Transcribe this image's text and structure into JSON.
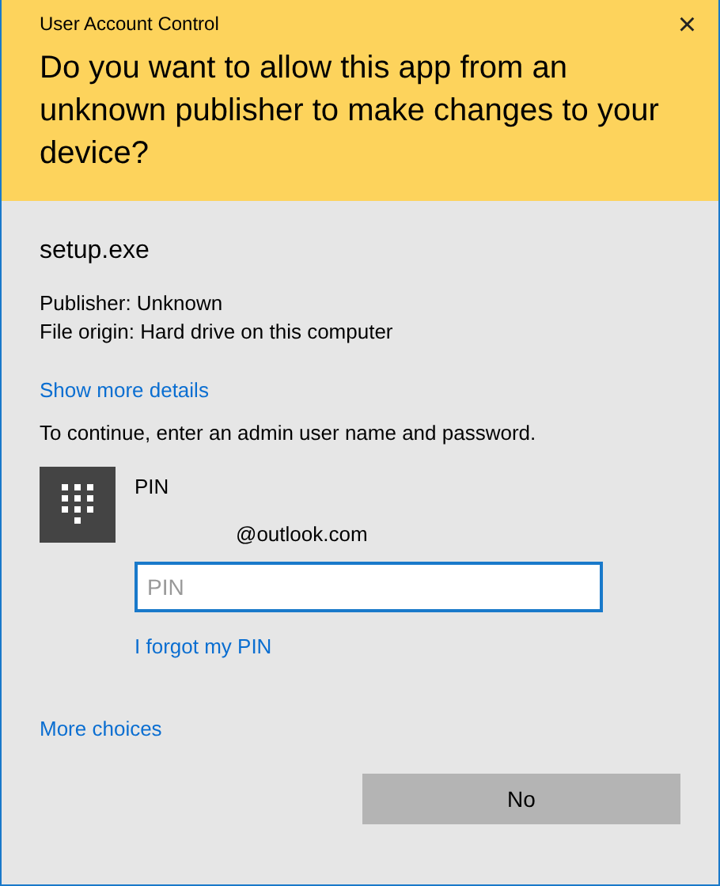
{
  "window": {
    "title": "User Account Control",
    "close": "×"
  },
  "question": "Do you want to allow this app from an unknown publisher to make changes to your device?",
  "app": {
    "name": "setup.exe",
    "publisher": "Publisher: Unknown",
    "origin": "File origin: Hard drive on this computer"
  },
  "details_link": "Show more details",
  "instruction": "To continue, enter an admin user name and password.",
  "account": {
    "label": "PIN",
    "email": "@outlook.com",
    "placeholder": "PIN",
    "forgot_link": "I forgot my PIN"
  },
  "more_choices": "More choices",
  "buttons": [
    {
      "label": "No"
    }
  ]
}
